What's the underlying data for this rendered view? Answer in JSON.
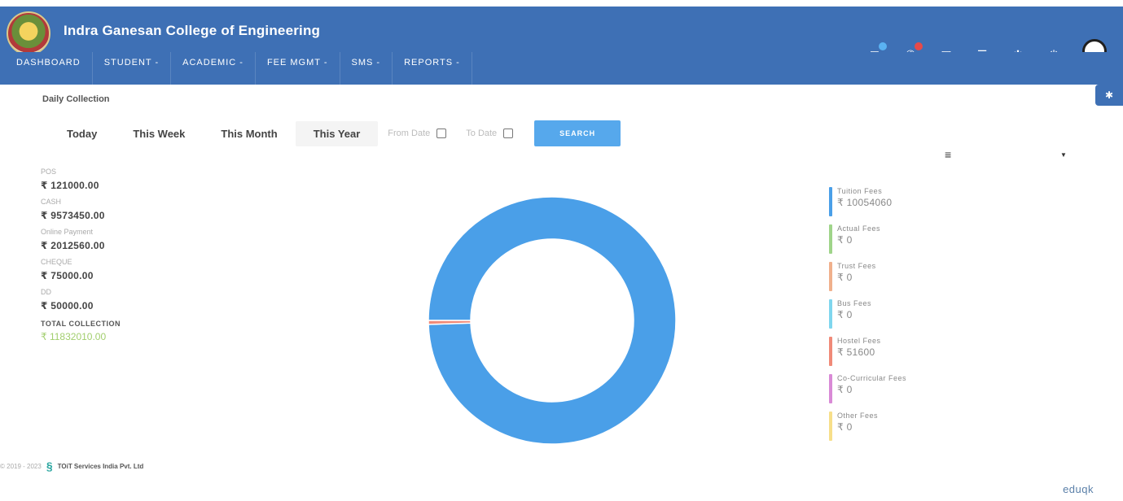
{
  "header": {
    "college_name": "Indra Ganesan College of Engineering",
    "links": [
      "",
      ""
    ],
    "brand_color": "#3e70b5"
  },
  "nav": {
    "items": [
      "DASHBOARD",
      "STUDENT -",
      "ACADEMIC -",
      "FEE MGMT -",
      "SMS -",
      "REPORTS -"
    ]
  },
  "page": {
    "section_title": "Daily Collection"
  },
  "filters": {
    "tabs": [
      "Today",
      "This Week",
      "This Month",
      "This Year"
    ],
    "active_tab": "This Year",
    "from_date_placeholder": "From Date",
    "to_date_placeholder": "To Date",
    "search_label": "SEARCH"
  },
  "collection": {
    "items": [
      {
        "label": "POS",
        "value": "₹ 121000.00"
      },
      {
        "label": "CASH",
        "value": "₹ 9573450.00"
      },
      {
        "label": "Online Payment",
        "value": "₹ 2012560.00"
      },
      {
        "label": "CHEQUE",
        "value": "₹ 75000.00"
      },
      {
        "label": "DD",
        "value": "₹ 50000.00"
      }
    ],
    "total_label": "TOTAL COLLECTION",
    "total_value": "₹ 11832010.00"
  },
  "chart_data": {
    "type": "pie",
    "categories": [
      "Tuition Fees",
      "Actual Fees",
      "Trust Fees",
      "Bus Fees",
      "Hostel Fees",
      "Co-Curricular Fees",
      "Other Fees"
    ],
    "values": [
      10054060,
      0,
      0,
      0,
      51600,
      0,
      0
    ],
    "colors": [
      "#4a9fe8",
      "#9fd48a",
      "#f0b08c",
      "#7fd6ee",
      "#f08a78",
      "#d98ad6",
      "#f7df8a"
    ]
  },
  "legend": {
    "items": [
      {
        "name": "Tuition Fees",
        "value": "₹ 10054060",
        "color": "#4a9fe8"
      },
      {
        "name": "Actual Fees",
        "value": "₹ 0",
        "color": "#9fd48a"
      },
      {
        "name": "Trust Fees",
        "value": "₹ 0",
        "color": "#f0b08c"
      },
      {
        "name": "Bus Fees",
        "value": "₹ 0",
        "color": "#7fd6ee"
      },
      {
        "name": "Hostel Fees",
        "value": "₹ 51600",
        "color": "#f08a78"
      },
      {
        "name": "Co-Curricular Fees",
        "value": "₹ 0",
        "color": "#d98ad6"
      },
      {
        "name": "Other Fees",
        "value": "₹ 0",
        "color": "#f7df8a"
      }
    ]
  },
  "footer": {
    "copyright": "© 2019 - 2023",
    "company": "TOiT Services India Pvt. Ltd",
    "edu": "eduqk"
  },
  "icons": {
    "chat": "chat-icon",
    "bell": "notification-icon",
    "calendar": "calendar-icon",
    "menu": "menu-icon",
    "settings": "gear-icon",
    "power": "power-icon"
  }
}
